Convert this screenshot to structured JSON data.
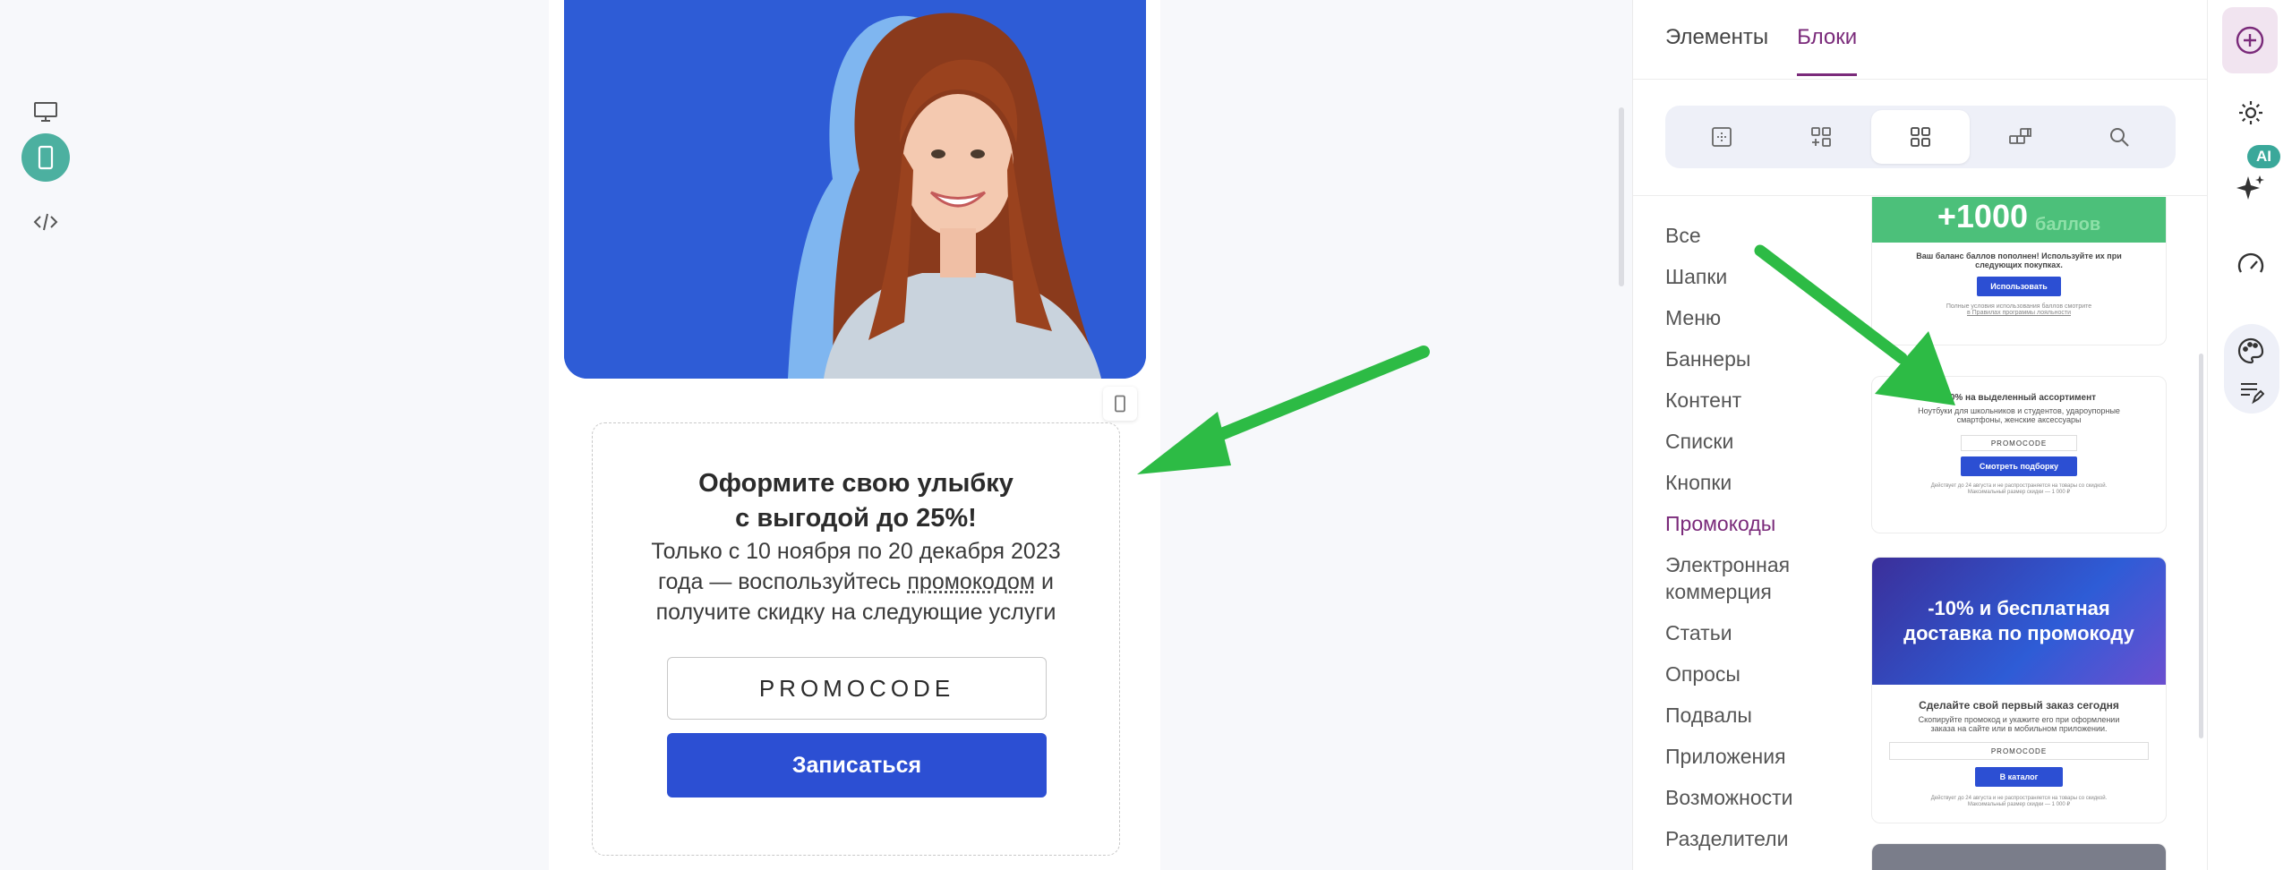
{
  "canvas": {
    "view_modes": [
      {
        "name": "desktop",
        "active": false
      },
      {
        "name": "mobile",
        "active": true
      },
      {
        "name": "code",
        "active": false
      }
    ]
  },
  "email": {
    "promo": {
      "title_line1": "Оформите свою улыбку",
      "title_line2": "с выгодой до 25%!",
      "text_line1": "Только с 10 ноября по 20 декабря 2023",
      "text_line2_a": "года — воспользуйтесь ",
      "text_line2_link": "промокодом",
      "text_line2_b": " и",
      "text_line3": "получите скидку на следующие услуги",
      "code": "PROMOCODE",
      "cta": "Записаться"
    }
  },
  "panel": {
    "tabs": [
      {
        "label": "Элементы",
        "active": false
      },
      {
        "label": "Блоки",
        "active": true
      }
    ],
    "icon_tabs": [
      "layout-icon",
      "add-grid-icon",
      "blocks-grid-icon",
      "components-icon",
      "search-icon"
    ],
    "active_icon_tab": 2,
    "categories": [
      "Все",
      "Шапки",
      "Меню",
      "Баннеры",
      "Контент",
      "Списки",
      "Кнопки",
      "Промокоды",
      "Электронная коммерция",
      "Статьи",
      "Опросы",
      "Подвалы",
      "Приложения",
      "Возможности",
      "Разделители"
    ],
    "active_category": "Промокоды",
    "thumbs": {
      "bonus": {
        "headline": "+1000",
        "headline_small": "баллов",
        "text": "Ваш баланс баллов пополнен! Используйте их при следующих покупках.",
        "button": "Использовать",
        "footnote_1": "Полные условия использования баллов смотрите",
        "footnote_2": "в Правилах программы лояльности"
      },
      "discount": {
        "headline": "-10% на выделенный ассортимент",
        "text": "Ноутбуки для школьников и студентов, удароупорные смартфоны, женские аксессуары",
        "code": "PROMOCODE",
        "button": "Смотреть подборку",
        "footnote_1": "Действует до 24 августа и не распространяется на товары со скидкой.",
        "footnote_2": "Максимальный размер скидки — 1 000 ₽"
      },
      "delivery": {
        "banner": "-10% и бесплатная доставка по промокоду",
        "headline": "Сделайте свой первый заказ сегодня",
        "text": "Скопируйте промокод и укажите его при оформлении заказа на сайте или в мобильном приложении.",
        "code": "PROMOCODE",
        "button": "В каталог",
        "footnote_1": "Действует до 24 августа и не распространяется на товары со скидкой.",
        "footnote_2": "Максимальный размер скидки — 1 000 ₽"
      }
    }
  },
  "rail": {
    "ai_badge": "AI",
    "buttons": [
      "add-block-icon",
      "settings-gear-icon",
      "ai-sparkles-icon",
      "speedometer-icon",
      "palette-icon",
      "notes-edit-icon"
    ]
  },
  "colors": {
    "accent_purple": "#7a2a7a",
    "brand_blue": "#2c4fd3",
    "hero_blue": "#2e5cd6",
    "teal": "#4cb0a0",
    "arrow_green": "#2dbb45"
  }
}
